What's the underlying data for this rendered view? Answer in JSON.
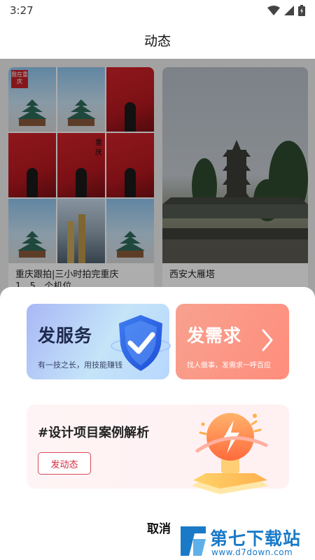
{
  "status_bar": {
    "time": "3:27"
  },
  "header": {
    "title": "动态"
  },
  "feed": {
    "cards": [
      {
        "title": "重庆跟拍|三小时拍完重庆1...5...个机位",
        "collage_text": [
          "我在重庆",
          "重庆",
          "我在重庆"
        ]
      },
      {
        "title": "西安大雁塔"
      }
    ]
  },
  "sheet": {
    "service": {
      "title": "发服务",
      "subtitle": "有一技之长，用技能赚钱"
    },
    "demand": {
      "title": "发需求",
      "subtitle": "找人做事，发需求一呼百应"
    },
    "topic": {
      "title": "#设计项目案例解析",
      "button": "发动态"
    },
    "cancel": "取消"
  },
  "watermark": {
    "brand": "第七下载站",
    "url": "www.d7down.com"
  },
  "colors": {
    "accent_red": "#d22a3e",
    "demand_orange": "#ff8d7c",
    "service_blue": "#a9b7f6",
    "watermark_blue": "#1a7ac8"
  }
}
